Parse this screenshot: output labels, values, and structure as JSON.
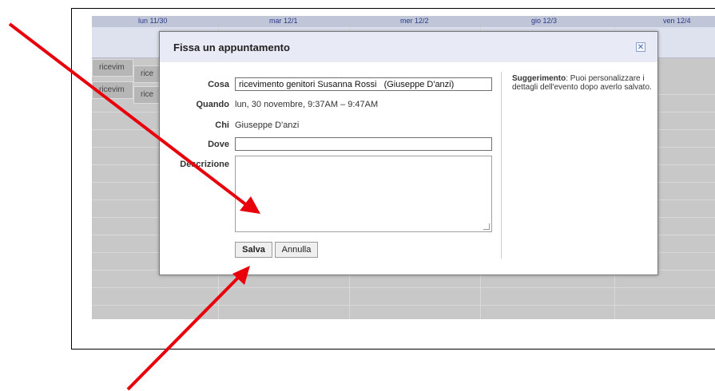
{
  "calendar": {
    "days": [
      "lun 11/30",
      "mar 12/1",
      "mer 12/2",
      "gio 12/3",
      "ven 12/4"
    ],
    "events": [
      "ricevim",
      "rice",
      "ricevim",
      "rice"
    ]
  },
  "dialog": {
    "title": "Fissa un appuntamento",
    "close_glyph": "✕",
    "cosa_label": "Cosa",
    "cosa_value": "ricevimento genitori Susanna Rossi   (Giuseppe D'anzi)",
    "quando_label": "Quando",
    "quando_value": "lun, 30 novembre, 9:37AM – 9:47AM",
    "chi_label": "Chi",
    "chi_value": "Giuseppe D'anzi",
    "dove_label": "Dove",
    "dove_value": "",
    "descrizione_label": "Descrizione",
    "save_label": "Salva",
    "cancel_label": "Annulla",
    "hint_bold": "Suggerimento",
    "hint_text": ": Puoi personalizzare i dettagli dell'evento dopo averlo salvato."
  },
  "annotation": {
    "arrow_color": "#e8000b"
  }
}
